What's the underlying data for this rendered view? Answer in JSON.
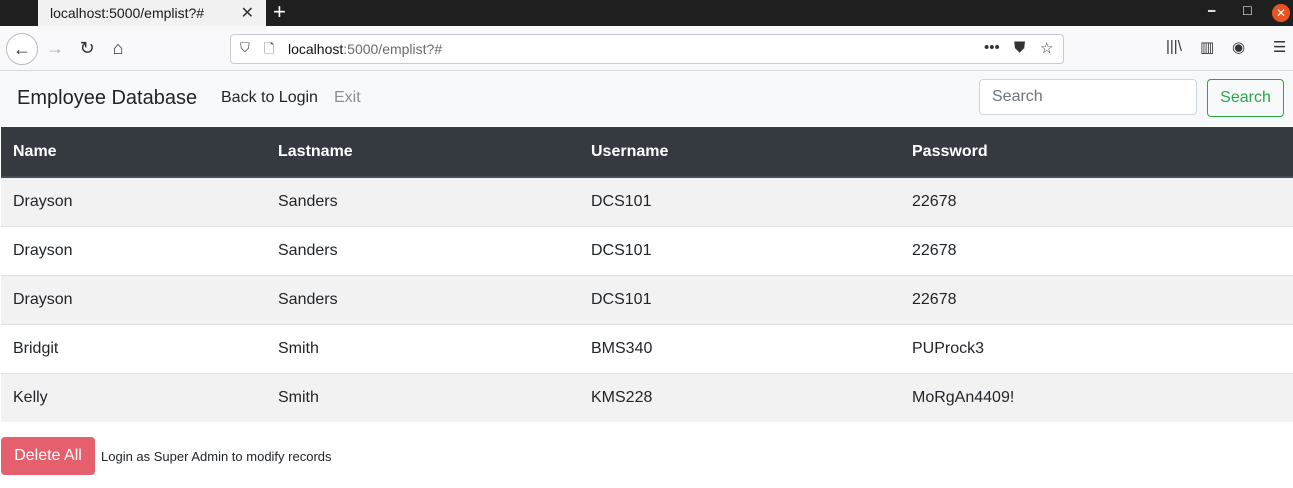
{
  "browser": {
    "tab_title": "localhost:5000/emplist?#",
    "url_host": "localhost",
    "url_rest": ":5000/emplist?#"
  },
  "nav": {
    "brand": "Employee Database",
    "back_to_login": "Back to Login",
    "exit": "Exit",
    "search_placeholder": "Search",
    "search_button": "Search"
  },
  "table": {
    "headers": [
      "Name",
      "Lastname",
      "Username",
      "Password"
    ],
    "rows": [
      [
        "Drayson",
        "Sanders",
        "DCS101",
        "22678"
      ],
      [
        "Drayson",
        "Sanders",
        "DCS101",
        "22678"
      ],
      [
        "Drayson",
        "Sanders",
        "DCS101",
        "22678"
      ],
      [
        "Bridgit",
        "Smith",
        "BMS340",
        "PUProck3"
      ],
      [
        "Kelly",
        "Smith",
        "KMS228",
        "MoRgAn4409!"
      ]
    ]
  },
  "footer": {
    "delete_all": "Delete All",
    "note": "Login as Super Admin to modify records"
  },
  "colors": {
    "accent_green": "#28a745",
    "table_header": "#343a40",
    "delete_button": "#e4606d"
  }
}
